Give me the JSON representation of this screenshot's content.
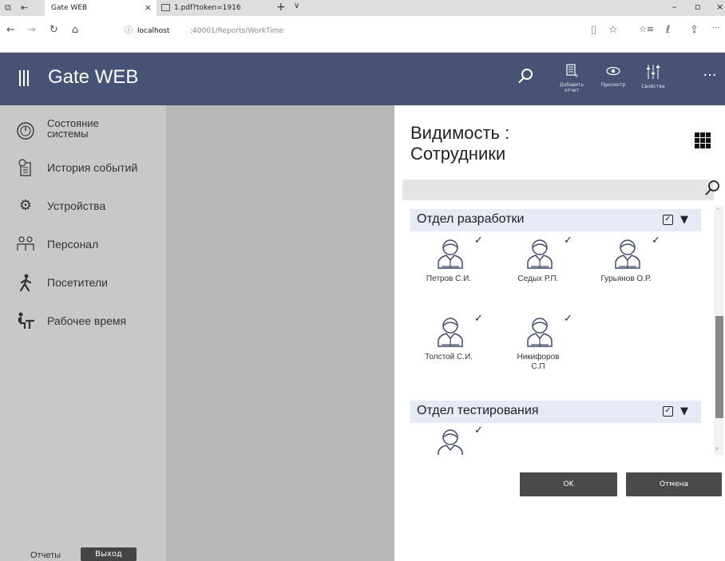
{
  "browser": {
    "tabs": [
      {
        "title": "Gate WEB",
        "close": "×"
      },
      {
        "title": "1.pdf?token=1916"
      }
    ],
    "new_tab": "+",
    "tab_menu": "∨",
    "window_controls": {
      "minimize": "–",
      "maximize": "▫",
      "close": "×"
    },
    "url_host": "localhost",
    "url_path": ":40001/Reports/WorkTime",
    "nav_icons": {
      "back": "←",
      "forward": "→",
      "refresh": "↻",
      "home": "⌂",
      "info": "ⓘ",
      "reading": "▯",
      "favorite": "☆",
      "favorites_list": "☆≡",
      "notes": "ℓ",
      "share": "⇪",
      "more": "···"
    }
  },
  "app": {
    "title": "Gate WEB",
    "header_actions": [
      {
        "icon": "search-icon",
        "label": ""
      },
      {
        "icon": "add-report-icon",
        "label": "Добавить отчет"
      },
      {
        "icon": "eye-icon",
        "label": "Просмотр"
      },
      {
        "icon": "sliders-icon",
        "label": "Свойства"
      },
      {
        "icon": "more-icon",
        "label": ""
      }
    ]
  },
  "sidebar": {
    "items": [
      {
        "label": "Состояние системы",
        "icon": "gauge-icon"
      },
      {
        "label": "История событий",
        "icon": "history-icon"
      },
      {
        "label": "Устройства",
        "icon": "gear-icon"
      },
      {
        "label": "Персонал",
        "icon": "staff-icon"
      },
      {
        "label": "Посетители",
        "icon": "walker-icon"
      },
      {
        "label": "Рабочее время",
        "icon": "workdesk-icon"
      }
    ],
    "footer_reports": "Отчеты",
    "footer_exit": "Выход"
  },
  "dialog": {
    "title_line1": "Видимость :",
    "title_line2": "Сотрудники",
    "search_value": "",
    "groups": [
      {
        "name": "Отдел разработки",
        "checked": true,
        "employees": [
          {
            "name": "Петров С.И.",
            "checked": true
          },
          {
            "name": "Седых Р.П.",
            "checked": true
          },
          {
            "name": "Гурьянов О.Р.",
            "checked": true
          },
          {
            "name": "Толстой С.И.",
            "checked": true
          },
          {
            "name": "Никифоров С.П",
            "checked": true
          }
        ]
      },
      {
        "name": "Отдел тестирования",
        "checked": true,
        "employees": [
          {
            "name": "",
            "checked": true
          }
        ]
      }
    ],
    "ok_label": "OK",
    "cancel_label": "Отмена"
  },
  "colors": {
    "appbar": "#475274",
    "sidebar": "#c8c8c8",
    "middle": "#b8b8b8",
    "group_bg": "#e6eaf5",
    "avatar_stroke": "#3f4a6b",
    "button": "#4a4a4a"
  }
}
